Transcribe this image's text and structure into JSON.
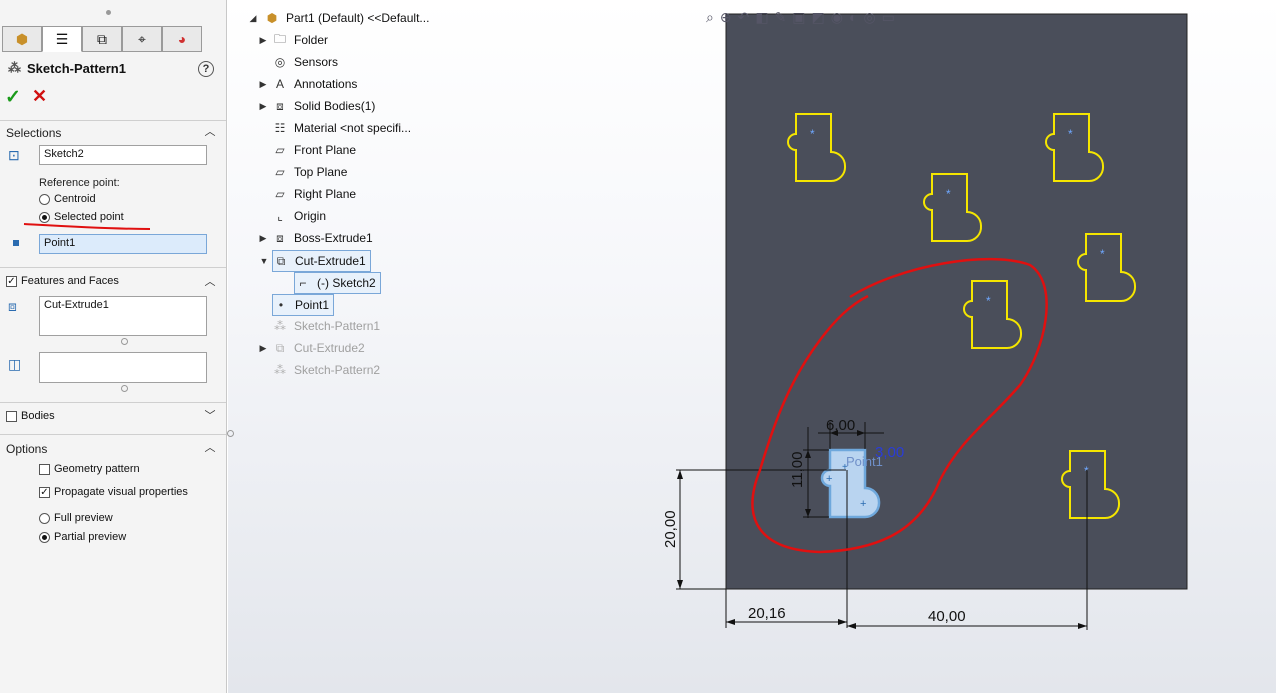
{
  "property_manager": {
    "title": "Sketch-Pattern1",
    "tabs": [
      "feature-manager",
      "property-manager",
      "configuration-manager",
      "dimxpert-manager",
      "display-manager"
    ],
    "selections": {
      "header": "Selections",
      "sketch_value": "Sketch2",
      "reference_point_label": "Reference point:",
      "option_centroid": "Centroid",
      "option_selected_point": "Selected point",
      "selected_option": "Selected point",
      "point_value": "Point1"
    },
    "features_and_faces": {
      "header": "Features and Faces",
      "checked": true,
      "features_value": "Cut-Extrude1",
      "faces_value": ""
    },
    "bodies": {
      "header": "Bodies",
      "checked": false
    },
    "options": {
      "header": "Options",
      "geometry_pattern": {
        "label": "Geometry pattern",
        "checked": false
      },
      "propagate_visual": {
        "label": "Propagate visual properties",
        "checked": true
      },
      "full_preview": "Full preview",
      "partial_preview": "Partial preview",
      "selected_preview": "Partial preview"
    }
  },
  "tree": {
    "root": "Part1 (Default) <<Default...",
    "items": [
      {
        "label": "Folder",
        "expandable": true
      },
      {
        "label": "Sensors",
        "expandable": false
      },
      {
        "label": "Annotations",
        "expandable": true
      },
      {
        "label": "Solid Bodies(1)",
        "expandable": true
      },
      {
        "label": "Material <not specifi...",
        "expandable": false
      },
      {
        "label": "Front Plane",
        "expandable": false
      },
      {
        "label": "Top Plane",
        "expandable": false
      },
      {
        "label": "Right Plane",
        "expandable": false
      },
      {
        "label": "Origin",
        "expandable": false
      },
      {
        "label": "Boss-Extrude1",
        "expandable": true
      },
      {
        "label": "Cut-Extrude1",
        "expandable": true,
        "expanded": true
      },
      {
        "label": "(-) Sketch2",
        "child": true
      },
      {
        "label": "Point1",
        "selected": true
      },
      {
        "label": "Sketch-Pattern1",
        "dimmed": true
      },
      {
        "label": "Cut-Extrude2",
        "dimmed": true,
        "expandable": true
      },
      {
        "label": "Sketch-Pattern2",
        "dimmed": true
      }
    ]
  },
  "viewport": {
    "dimensions": {
      "width_6": "6,00",
      "offset_3": "3,00",
      "height_11": "11,00",
      "vertical_20": "20,00",
      "horizontal_20_16": "20,16",
      "horizontal_40": "40,00"
    },
    "point_label": "Point1",
    "colors": {
      "part_face": "#4a4e5a",
      "pattern_outline": "#f5e600",
      "selected_sketch": "#6fa8dc",
      "annotation_red": "#e01010",
      "dimension_blue": "#2a3cd8"
    }
  }
}
